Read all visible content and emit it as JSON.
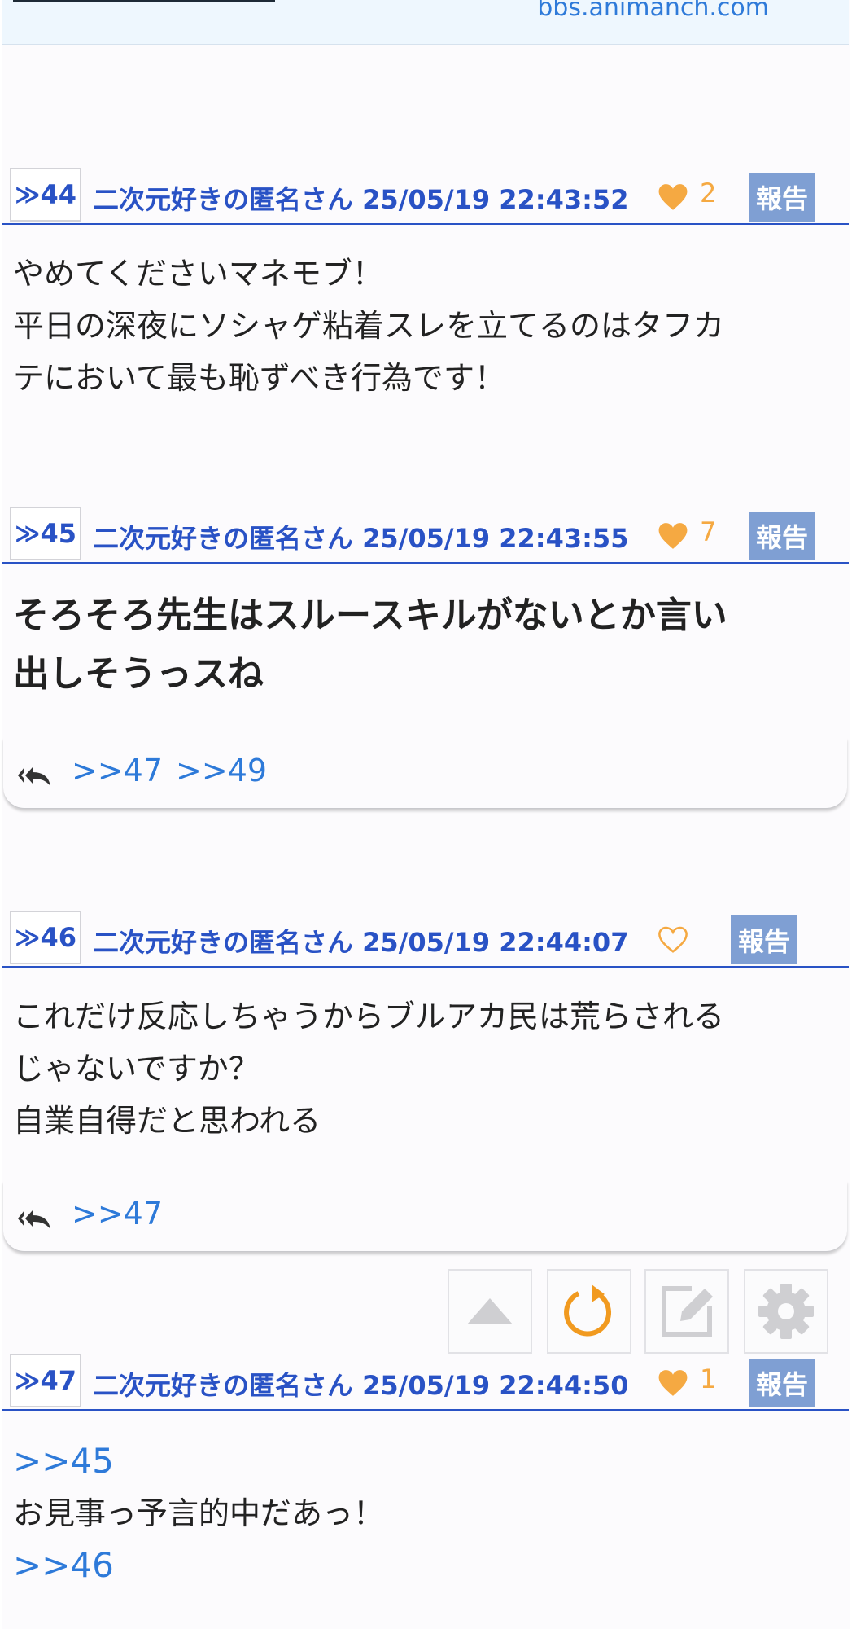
{
  "header": {
    "domain": "bbs.animanch.com"
  },
  "posts": [
    {
      "number": "44",
      "author": "二次元好きの匿名さん",
      "datetime": "25/05/19 22:43:52",
      "likes": "2",
      "report_label": "報告",
      "lines": [
        "やめてくださいマネモブ！",
        "平日の深夜にソシャゲ粘着スレを立てるのはタフカ",
        "テにおいて最も恥ずべき行為です！"
      ]
    },
    {
      "number": "45",
      "author": "二次元好きの匿名さん",
      "datetime": "25/05/19 22:43:55",
      "likes": "7",
      "report_label": "報告",
      "lines": [
        "そろそろ先生はスルースキルがないとか言い",
        "出しそうっスね"
      ],
      "replies": [
        ">>47",
        ">>49"
      ]
    },
    {
      "number": "46",
      "author": "二次元好きの匿名さん",
      "datetime": "25/05/19 22:44:07",
      "likes": "",
      "report_label": "報告",
      "lines": [
        "これだけ反応しちゃうからブルアカ民は荒らされる",
        "じゃないですか？",
        "自業自得だと思われる"
      ],
      "replies": [
        ">>47"
      ]
    },
    {
      "number": "47",
      "author": "二次元好きの匿名さん",
      "datetime": "25/05/19 22:44:50",
      "likes": "1",
      "report_label": "報告",
      "anchor_top": ">>45",
      "lines": [
        "お見事っ予言的中だあっ！"
      ],
      "anchor_bottom": ">>46"
    }
  ],
  "colors": {
    "accent": "#2952c5",
    "link": "#2e7ad9",
    "heart": "#f5a942",
    "report_bg": "#7f9fd3"
  },
  "toolbar": {
    "icons": [
      "scroll-top-icon",
      "refresh-icon",
      "compose-icon",
      "settings-icon"
    ]
  }
}
